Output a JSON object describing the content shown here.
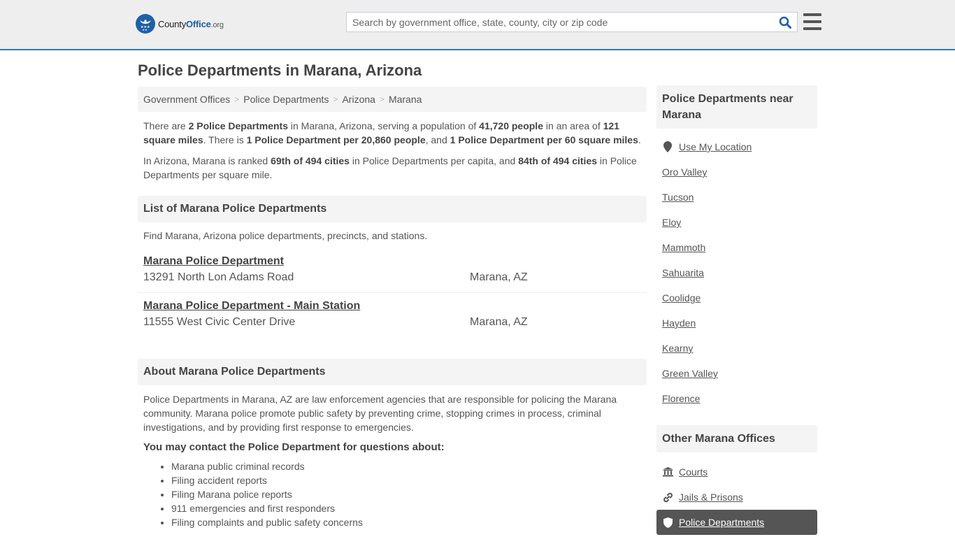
{
  "header": {
    "logo": {
      "county": "County",
      "office": "Office",
      "org": ".org"
    },
    "search_placeholder": "Search by government office, state, county, city or zip code",
    "colors": {
      "brand": "#2060a8",
      "accent_line": "#337ab7"
    }
  },
  "page_title": "Police Departments in Marana, Arizona",
  "breadcrumb": [
    "Government Offices",
    "Police Departments",
    "Arizona",
    "Marana"
  ],
  "summary": {
    "p1": {
      "t1": "There are ",
      "b1": "2 Police Departments",
      "t2": " in Marana, Arizona, serving a population of ",
      "b2": "41,720 people",
      "t3": " in an area of ",
      "b3": "121 square miles",
      "t4": ". There is ",
      "b4": "1 Police Department per 20,860 people",
      "t5": ", and ",
      "b5": "1 Police Department per 60 square miles",
      "t6": "."
    },
    "p2": {
      "t1": "In Arizona, Marana is ranked ",
      "b1": "69th of 494 cities",
      "t2": " in Police Departments per capita, and ",
      "b2": "84th of 494 cities",
      "t3": " in Police Departments per square mile."
    }
  },
  "list_section": {
    "title": "List of Marana Police Departments",
    "description": "Find Marana, Arizona police departments, precincts, and stations.",
    "listings": [
      {
        "name": "Marana Police Department",
        "address": "13291 North Lon Adams Road",
        "city": "Marana, AZ"
      },
      {
        "name": "Marana Police Department - Main Station",
        "address": "11555 West Civic Center Drive",
        "city": "Marana, AZ"
      }
    ]
  },
  "about_section": {
    "title": "About Marana Police Departments",
    "text": "Police Departments in Marana, AZ are law enforcement agencies that are responsible for policing the Marana community. Marana police promote public safety by preventing crime, stopping crimes in process, criminal investigations, and by providing first response to emergencies.",
    "contact_heading": "You may contact the Police Department for questions about:",
    "contact_items": [
      "Marana public criminal records",
      "Filing accident reports",
      "Filing Marana police reports",
      "911 emergencies and first responders",
      "Filing complaints and public safety concerns"
    ]
  },
  "sidebar": {
    "nearby_title": "Police Departments near Marana",
    "use_location": "Use My Location",
    "nearby": [
      "Oro Valley",
      "Tucson",
      "Eloy",
      "Mammoth",
      "Sahuarita",
      "Coolidge",
      "Hayden",
      "Kearny",
      "Green Valley",
      "Florence"
    ],
    "other_title": "Other Marana Offices",
    "other": [
      {
        "label": "Courts",
        "icon": "courthouse-icon"
      },
      {
        "label": "Jails & Prisons",
        "icon": "link-icon"
      },
      {
        "label": "Police Departments",
        "icon": "shield-icon",
        "active": true
      }
    ]
  }
}
